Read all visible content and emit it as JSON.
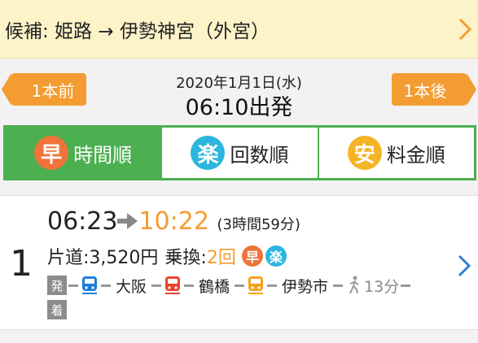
{
  "header": {
    "candidate_text": "候補: 姫路 → 伊勢神宮（外宮）"
  },
  "nav": {
    "prev_label": "1本前",
    "next_label": "1本後",
    "date": "2020年1月1日(水)",
    "departure": "06:10出発"
  },
  "sort_tabs": [
    {
      "badge": "早",
      "label": "時間順",
      "active": true
    },
    {
      "badge": "楽",
      "label": "回数順",
      "active": false
    },
    {
      "badge": "安",
      "label": "料金順",
      "active": false
    }
  ],
  "route": {
    "number": "1",
    "depart_time": "06:23",
    "arrive_time": "10:22",
    "duration": "(3時間59分)",
    "fare_label": "片道:",
    "fare_value": "3,520円",
    "transfer_label": "乗換:",
    "transfer_value": "2回",
    "badges": [
      "早",
      "楽"
    ],
    "depart_tag": "発",
    "arrive_tag": "着",
    "stations": [
      "大阪",
      "鶴橋",
      "伊勢市"
    ],
    "walk_time": "13分"
  },
  "colors": {
    "accent_orange": "#f39c32",
    "tab_green": "#4caf50",
    "badge_fast": "#f0733a",
    "badge_easy": "#2bb6df",
    "badge_cheap": "#f5b426",
    "train_blue": "#1e7fd8",
    "train_red": "#e8432e",
    "train_amber": "#f2a21e"
  }
}
